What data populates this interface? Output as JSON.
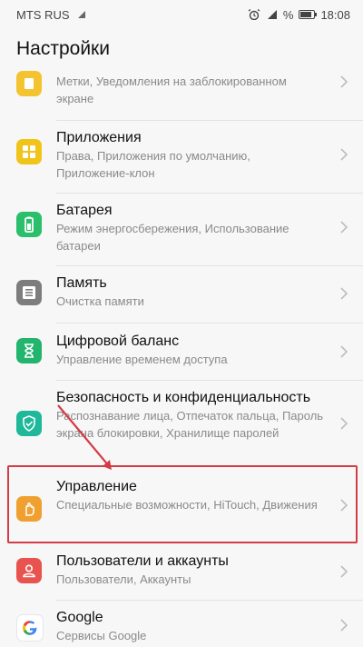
{
  "status_bar": {
    "carrier": "MTS RUS",
    "time": "18:08",
    "battery_label": "% "
  },
  "header": {
    "title": "Настройки"
  },
  "settings": [
    {
      "title": "",
      "subtitle": "Метки, Уведомления на заблокированном экране",
      "icon": "lock-screen-icon",
      "color": "#f4c430"
    },
    {
      "title": "Приложения",
      "subtitle": "Права, Приложения по умолчанию, Приложение-клон",
      "icon": "apps-icon",
      "color": "#f0c419"
    },
    {
      "title": "Батарея",
      "subtitle": "Режим энергосбережения, Использование батареи",
      "icon": "battery-icon",
      "color": "#2bbf6b"
    },
    {
      "title": "Память",
      "subtitle": "Очистка памяти",
      "icon": "storage-icon",
      "color": "#7d7d7d"
    },
    {
      "title": "Цифровой баланс",
      "subtitle": "Управление временем доступа",
      "icon": "hourglass-icon",
      "color": "#23b46e"
    },
    {
      "title": "Безопасность и конфиденциальность",
      "subtitle": "Распознавание лица, Отпечаток пальца, Пароль экрана блокировки, Хранилище паролей",
      "icon": "shield-icon",
      "color": "#1fb89a"
    },
    {
      "title": "Управление",
      "subtitle": "Специальные возможности, HiTouch, Движения",
      "icon": "hand-icon",
      "color": "#f0a030"
    },
    {
      "title": "Пользователи и аккаунты",
      "subtitle": "Пользователи, Аккаунты",
      "icon": "user-icon",
      "color": "#e8534f"
    },
    {
      "title": "Google",
      "subtitle": "Сервисы Google",
      "icon": "google-icon",
      "color": "#ffffff"
    }
  ]
}
